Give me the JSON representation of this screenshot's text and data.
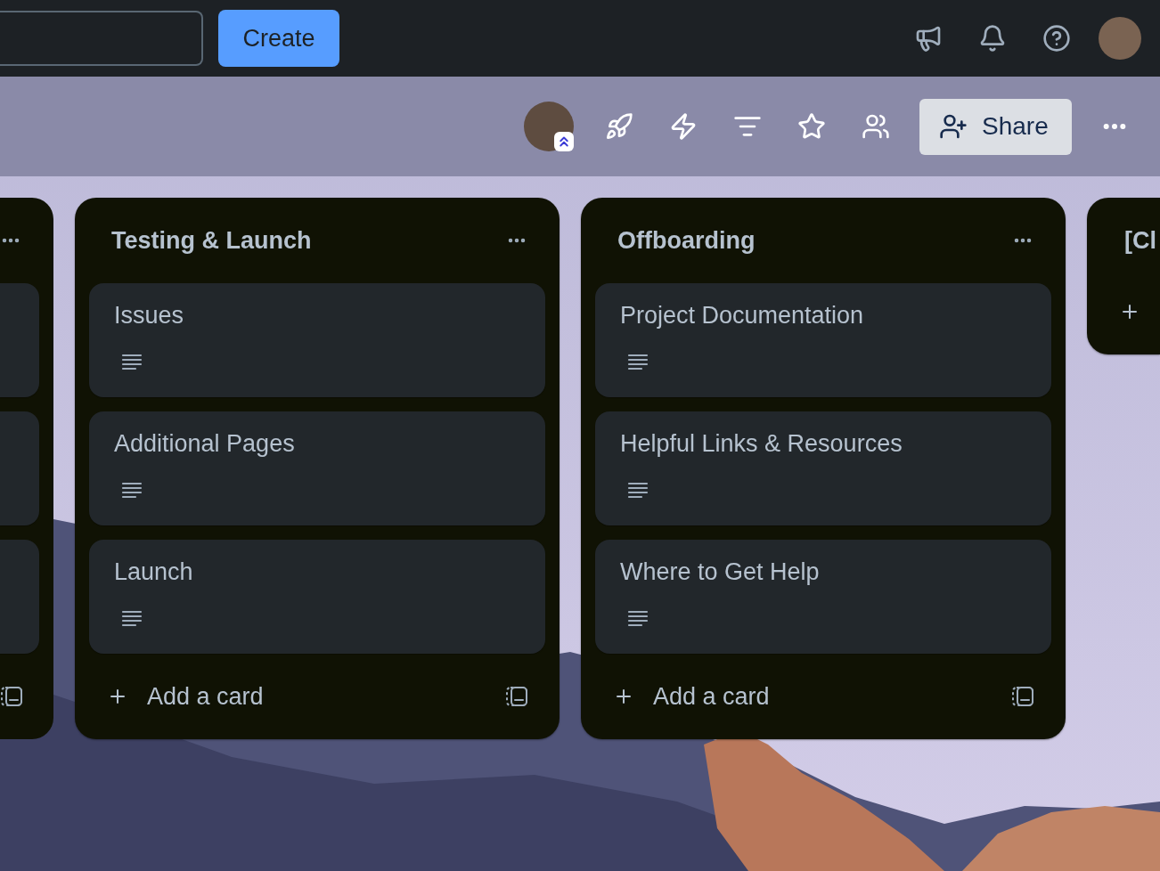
{
  "top_bar": {
    "create_button": "Create"
  },
  "board_header": {
    "share_button": "Share"
  },
  "lists": [
    {
      "kind": "clipped_left",
      "cards": [
        {
          "kind": "clipped"
        },
        {
          "kind": "clipped"
        },
        {
          "kind": "clipped"
        }
      ]
    },
    {
      "kind": "full",
      "title": "Testing & Launch",
      "cards": [
        {
          "kind": "full",
          "title": "Issues",
          "description": true
        },
        {
          "kind": "full",
          "title": "Additional Pages",
          "description": true
        },
        {
          "kind": "full",
          "title": "Launch",
          "description": true
        }
      ],
      "add_card": "Add a card"
    },
    {
      "kind": "full",
      "title": "Offboarding",
      "cards": [
        {
          "kind": "full",
          "title": "Project Documentation",
          "description": true
        },
        {
          "kind": "full",
          "title": "Helpful Links & Resources",
          "description": true
        },
        {
          "kind": "full",
          "title": "Where to Get Help",
          "description": true
        }
      ],
      "add_card": "Add a card"
    },
    {
      "kind": "clipped_right",
      "title": "[Cl"
    }
  ]
}
